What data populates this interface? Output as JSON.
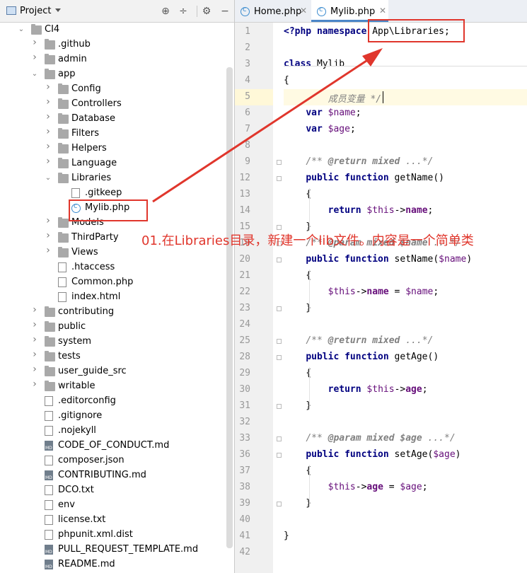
{
  "project_panel": {
    "title": "Project",
    "tree": [
      {
        "label": "CI4",
        "depth": 0,
        "kind": "folder",
        "expanded": true
      },
      {
        "label": ".github",
        "depth": 1,
        "kind": "folder",
        "expanded": false
      },
      {
        "label": "admin",
        "depth": 1,
        "kind": "folder",
        "expanded": false
      },
      {
        "label": "app",
        "depth": 1,
        "kind": "folder",
        "expanded": true
      },
      {
        "label": "Config",
        "depth": 2,
        "kind": "folder",
        "expanded": false
      },
      {
        "label": "Controllers",
        "depth": 2,
        "kind": "folder",
        "expanded": false
      },
      {
        "label": "Database",
        "depth": 2,
        "kind": "folder",
        "expanded": false
      },
      {
        "label": "Filters",
        "depth": 2,
        "kind": "folder",
        "expanded": false
      },
      {
        "label": "Helpers",
        "depth": 2,
        "kind": "folder",
        "expanded": false
      },
      {
        "label": "Language",
        "depth": 2,
        "kind": "folder",
        "expanded": false
      },
      {
        "label": "Libraries",
        "depth": 2,
        "kind": "folder",
        "expanded": true
      },
      {
        "label": ".gitkeep",
        "depth": 3,
        "kind": "file"
      },
      {
        "label": "Mylib.php",
        "depth": 3,
        "kind": "class"
      },
      {
        "label": "Models",
        "depth": 2,
        "kind": "folder",
        "expanded": false
      },
      {
        "label": "ThirdParty",
        "depth": 2,
        "kind": "folder",
        "expanded": false
      },
      {
        "label": "Views",
        "depth": 2,
        "kind": "folder",
        "expanded": false
      },
      {
        "label": ".htaccess",
        "depth": 2,
        "kind": "file"
      },
      {
        "label": "Common.php",
        "depth": 2,
        "kind": "file"
      },
      {
        "label": "index.html",
        "depth": 2,
        "kind": "file"
      },
      {
        "label": "contributing",
        "depth": 1,
        "kind": "folder",
        "expanded": false
      },
      {
        "label": "public",
        "depth": 1,
        "kind": "folder",
        "expanded": false
      },
      {
        "label": "system",
        "depth": 1,
        "kind": "folder",
        "expanded": false
      },
      {
        "label": "tests",
        "depth": 1,
        "kind": "folder",
        "expanded": false
      },
      {
        "label": "user_guide_src",
        "depth": 1,
        "kind": "folder",
        "expanded": false
      },
      {
        "label": "writable",
        "depth": 1,
        "kind": "folder",
        "expanded": false
      },
      {
        "label": ".editorconfig",
        "depth": 1,
        "kind": "file"
      },
      {
        "label": ".gitignore",
        "depth": 1,
        "kind": "file"
      },
      {
        "label": ".nojekyll",
        "depth": 1,
        "kind": "file"
      },
      {
        "label": "CODE_OF_CONDUCT.md",
        "depth": 1,
        "kind": "md"
      },
      {
        "label": "composer.json",
        "depth": 1,
        "kind": "file"
      },
      {
        "label": "CONTRIBUTING.md",
        "depth": 1,
        "kind": "md"
      },
      {
        "label": "DCO.txt",
        "depth": 1,
        "kind": "file"
      },
      {
        "label": "env",
        "depth": 1,
        "kind": "file"
      },
      {
        "label": "license.txt",
        "depth": 1,
        "kind": "file"
      },
      {
        "label": "phpunit.xml.dist",
        "depth": 1,
        "kind": "file"
      },
      {
        "label": "PULL_REQUEST_TEMPLATE.md",
        "depth": 1,
        "kind": "md"
      },
      {
        "label": "README.md",
        "depth": 1,
        "kind": "md"
      }
    ]
  },
  "editor": {
    "tabs": [
      {
        "label": "Home.php",
        "active": false
      },
      {
        "label": "Mylib.php",
        "active": true
      }
    ],
    "lines": [
      {
        "n": "1",
        "fold": false,
        "segs": [
          [
            "kw",
            "<?php namespace "
          ],
          [
            "txt",
            "App\\Libraries;"
          ]
        ]
      },
      {
        "n": "2",
        "fold": false,
        "segs": []
      },
      {
        "n": "3",
        "fold": false,
        "segs": [
          [
            "kw",
            "class "
          ],
          [
            "txt",
            "Mylib"
          ]
        ]
      },
      {
        "n": "4",
        "fold": false,
        "segs": [
          [
            "txt",
            "{"
          ]
        ]
      },
      {
        "n": "5",
        "fold": false,
        "current": true,
        "segs": [
          [
            "txt",
            "        "
          ],
          [
            "cmt",
            "成员变量 */"
          ]
        ]
      },
      {
        "n": "6",
        "fold": false,
        "segs": [
          [
            "txt",
            "    "
          ],
          [
            "kw",
            "var "
          ],
          [
            "var",
            "$name"
          ],
          [
            "txt",
            ";"
          ]
        ]
      },
      {
        "n": "7",
        "fold": false,
        "segs": [
          [
            "txt",
            "    "
          ],
          [
            "kw",
            "var "
          ],
          [
            "var",
            "$age"
          ],
          [
            "txt",
            ";"
          ]
        ]
      },
      {
        "n": "8",
        "fold": false,
        "segs": []
      },
      {
        "n": "9",
        "fold": true,
        "segs": [
          [
            "txt",
            "    "
          ],
          [
            "cmt",
            "/** "
          ],
          [
            "tag",
            "@return"
          ],
          [
            "cmt",
            " "
          ],
          [
            "tag",
            "mixed"
          ],
          [
            "cmt",
            " ...*/"
          ]
        ]
      },
      {
        "n": "12",
        "fold": true,
        "segs": [
          [
            "txt",
            "    "
          ],
          [
            "kw",
            "public function "
          ],
          [
            "txt",
            "getName()"
          ]
        ]
      },
      {
        "n": "13",
        "fold": false,
        "segs": [
          [
            "txt",
            "    {"
          ]
        ]
      },
      {
        "n": "14",
        "fold": false,
        "segs": [
          [
            "txt",
            "        "
          ],
          [
            "kw",
            "return "
          ],
          [
            "var",
            "$this"
          ],
          [
            "txt",
            "->"
          ],
          [
            "prop",
            "name"
          ],
          [
            "txt",
            ";"
          ]
        ]
      },
      {
        "n": "15",
        "fold": true,
        "segs": [
          [
            "txt",
            "    }"
          ]
        ]
      },
      {
        "n": "16",
        "fold": true,
        "segs": [
          [
            "txt",
            "    "
          ],
          [
            "cmt",
            "/** "
          ],
          [
            "tag",
            "@param"
          ],
          [
            "cmt",
            " "
          ],
          [
            "tag",
            "mixed"
          ],
          [
            "cmt",
            " "
          ],
          [
            "tag",
            "$name"
          ],
          [
            "cmt",
            " ...*/"
          ]
        ]
      },
      {
        "n": "20",
        "fold": true,
        "segs": [
          [
            "txt",
            "    "
          ],
          [
            "kw",
            "public function "
          ],
          [
            "txt",
            "setName("
          ],
          [
            "var",
            "$name"
          ],
          [
            "txt",
            ")"
          ]
        ]
      },
      {
        "n": "21",
        "fold": false,
        "segs": [
          [
            "txt",
            "    {"
          ]
        ]
      },
      {
        "n": "22",
        "fold": false,
        "segs": [
          [
            "txt",
            "        "
          ],
          [
            "var",
            "$this"
          ],
          [
            "txt",
            "->"
          ],
          [
            "prop",
            "name"
          ],
          [
            "txt",
            " = "
          ],
          [
            "var",
            "$name"
          ],
          [
            "txt",
            ";"
          ]
        ]
      },
      {
        "n": "23",
        "fold": true,
        "segs": [
          [
            "txt",
            "    }"
          ]
        ]
      },
      {
        "n": "24",
        "fold": false,
        "segs": []
      },
      {
        "n": "25",
        "fold": true,
        "segs": [
          [
            "txt",
            "    "
          ],
          [
            "cmt",
            "/** "
          ],
          [
            "tag",
            "@return"
          ],
          [
            "cmt",
            " "
          ],
          [
            "tag",
            "mixed"
          ],
          [
            "cmt",
            " ...*/"
          ]
        ]
      },
      {
        "n": "28",
        "fold": true,
        "segs": [
          [
            "txt",
            "    "
          ],
          [
            "kw",
            "public function "
          ],
          [
            "txt",
            "getAge()"
          ]
        ]
      },
      {
        "n": "29",
        "fold": false,
        "segs": [
          [
            "txt",
            "    {"
          ]
        ]
      },
      {
        "n": "30",
        "fold": false,
        "segs": [
          [
            "txt",
            "        "
          ],
          [
            "kw",
            "return "
          ],
          [
            "var",
            "$this"
          ],
          [
            "txt",
            "->"
          ],
          [
            "prop",
            "age"
          ],
          [
            "txt",
            ";"
          ]
        ]
      },
      {
        "n": "31",
        "fold": true,
        "segs": [
          [
            "txt",
            "    }"
          ]
        ]
      },
      {
        "n": "32",
        "fold": false,
        "segs": []
      },
      {
        "n": "33",
        "fold": true,
        "segs": [
          [
            "txt",
            "    "
          ],
          [
            "cmt",
            "/** "
          ],
          [
            "tag",
            "@param"
          ],
          [
            "cmt",
            " "
          ],
          [
            "tag",
            "mixed"
          ],
          [
            "cmt",
            " "
          ],
          [
            "tag",
            "$age"
          ],
          [
            "cmt",
            " ...*/"
          ]
        ]
      },
      {
        "n": "36",
        "fold": true,
        "segs": [
          [
            "txt",
            "    "
          ],
          [
            "kw",
            "public function "
          ],
          [
            "txt",
            "setAge("
          ],
          [
            "var",
            "$age"
          ],
          [
            "txt",
            ")"
          ]
        ]
      },
      {
        "n": "37",
        "fold": false,
        "segs": [
          [
            "txt",
            "    {"
          ]
        ]
      },
      {
        "n": "38",
        "fold": false,
        "segs": [
          [
            "txt",
            "        "
          ],
          [
            "var",
            "$this"
          ],
          [
            "txt",
            "->"
          ],
          [
            "prop",
            "age"
          ],
          [
            "txt",
            " = "
          ],
          [
            "var",
            "$age"
          ],
          [
            "txt",
            ";"
          ]
        ]
      },
      {
        "n": "39",
        "fold": true,
        "segs": [
          [
            "txt",
            "    }"
          ]
        ]
      },
      {
        "n": "40",
        "fold": false,
        "segs": []
      },
      {
        "n": "41",
        "fold": false,
        "segs": [
          [
            "txt",
            "}"
          ]
        ]
      },
      {
        "n": "42",
        "fold": false,
        "segs": []
      }
    ]
  },
  "annotation": {
    "text": "01.在Libraries目录，新建一个lib文件。内容是一个简单类",
    "color": "#e0362c"
  }
}
